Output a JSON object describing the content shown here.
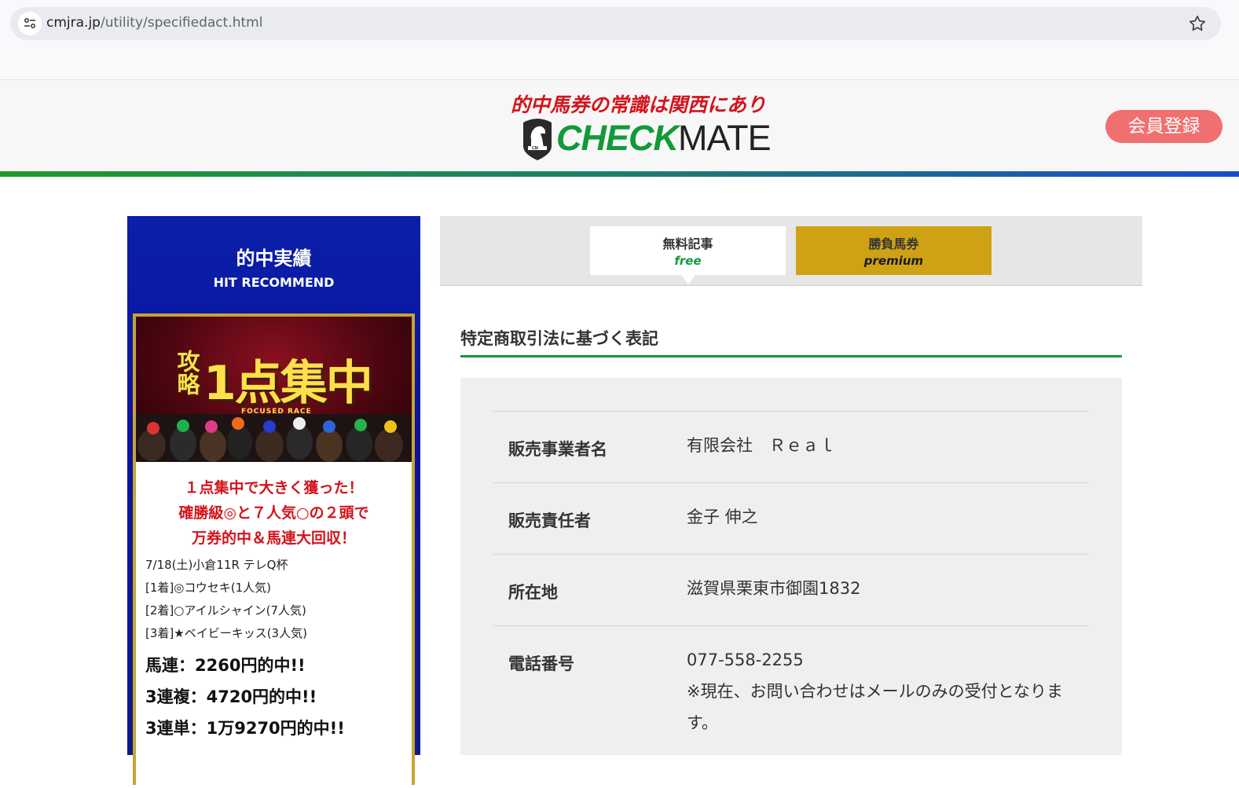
{
  "browser": {
    "url_host": "cmjra.jp",
    "url_path": "/utility/specifiedact.html"
  },
  "header": {
    "tagline": "的中馬券の常識は関西にあり",
    "logo_check": "CHECK",
    "logo_mate": "MATE",
    "register_label": "会員登録"
  },
  "sidebar": {
    "title": "的中実績",
    "subtitle": "HIT RECOMMEND",
    "banner": {
      "left_text": "攻略",
      "main_text": "1点集中",
      "sub_text": "FOCUSED RACE"
    },
    "headline": [
      "１点集中で大きく獲った！",
      "確勝級◎と７人気○の２頭で",
      "万券的中＆馬連大回収！"
    ],
    "race": [
      "7/18(土)小倉11R テレQ杯",
      "[1着]◎コウセキ(1人気)",
      "[2着]○アイルシャイン(7人気)",
      "[3着]★ベイビーキッス(3人気)"
    ],
    "payouts": [
      "馬連：2260円的中!!",
      "3連複：4720円的中!!",
      "3連単：1万9270円的中!!"
    ]
  },
  "tabs": {
    "free": {
      "label": "無料記事",
      "sub": "free"
    },
    "premium": {
      "label": "勝負馬券",
      "sub": "premium"
    }
  },
  "section": {
    "title": "特定商取引法に基づく表記"
  },
  "info": {
    "rows": [
      {
        "label": "販売事業者名",
        "value": "有限会社　Ｒｅａｌ"
      },
      {
        "label": "販売責任者",
        "value": "金子 伸之"
      },
      {
        "label": "所在地",
        "value": "滋賀県栗東市御園1832"
      },
      {
        "label": "電話番号",
        "value": "077-558-2255",
        "note": "※現在、お問い合わせはメールのみの受付となります。"
      }
    ]
  },
  "colors": {
    "brand_green": "#129a3a",
    "brand_red": "#d4131b",
    "register_pink": "#f07070",
    "premium_gold": "#cfa215",
    "sidebar_blue": "#0b1fa8"
  }
}
